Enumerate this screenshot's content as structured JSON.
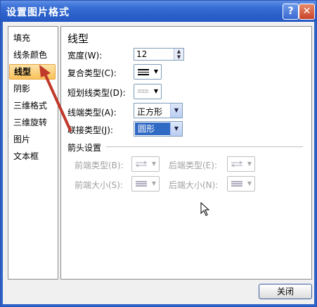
{
  "window": {
    "title": "设置图片格式",
    "help_glyph": "?",
    "close_glyph": "✕"
  },
  "nav": {
    "items": [
      "填充",
      "线条颜色",
      "线型",
      "阴影",
      "三维格式",
      "三维旋转",
      "图片",
      "文本框"
    ],
    "selected_index": 2
  },
  "panel": {
    "section_title": "线型",
    "width": {
      "label": "宽度(W):",
      "value": "12"
    },
    "compound_type": {
      "label": "复合类型(C):"
    },
    "dash_type": {
      "label": "短划线类型(D):"
    },
    "cap_type": {
      "label": "线端类型(A):",
      "value": "正方形"
    },
    "join_type": {
      "label": "联接类型(J):",
      "value": "圆形"
    },
    "arrow_settings": {
      "title": "箭头设置",
      "begin_type": "前端类型(B):",
      "end_type": "后端类型(E):",
      "begin_size": "前端大小(S):",
      "end_size": "后端大小(N):"
    }
  },
  "footer": {
    "close_label": "关闭"
  },
  "colors": {
    "titlebar": "#2b5fc9",
    "selected_nav": "#f9c25a",
    "annotation_arrow": "#c0392b",
    "combo_selected": "#316ac5"
  }
}
